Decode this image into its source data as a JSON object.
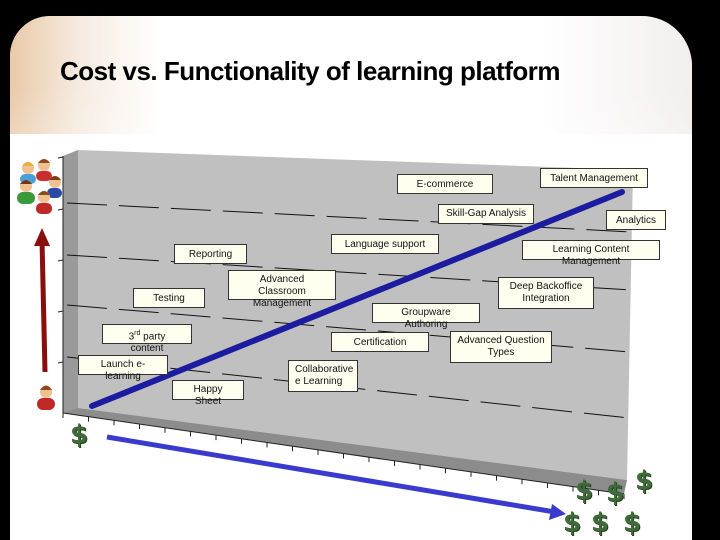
{
  "slide": {
    "title": "Cost vs. Functionality of learning platform"
  },
  "features": {
    "ecommerce": "E-commerce",
    "talent_management": "Talent Management",
    "skill_gap": "Skill-Gap Analysis",
    "analytics": "Analytics",
    "language_support": "Language support",
    "learning_content": "Learning Content Management",
    "reporting": "Reporting",
    "advanced_classroom": "Advanced Classroom Management",
    "deep_backoffice": "Deep Backoffice Integration",
    "testing": "Testing",
    "groupware": "Groupware Authoring",
    "third_party_num": "3",
    "third_party_sup": "rd",
    "third_party_rest": " party content",
    "certification": "Certification",
    "advanced_question": "Advanced Question Types",
    "launch": "Launch e-learning",
    "collaborative": "Collaborative e Learning",
    "happy_sheet": "Happy Sheet"
  },
  "axes": {
    "cost_symbol": "$",
    "functionality_icon": "group-of-people-icon",
    "single_user_icon": "person-icon"
  },
  "colors": {
    "trend_line": "#1c1ca0",
    "cost_arrow": "#3a3acf",
    "users_arrow": "#8b0e0e",
    "dollar": "#3f6a3a",
    "plane": "#c0c0c0"
  }
}
